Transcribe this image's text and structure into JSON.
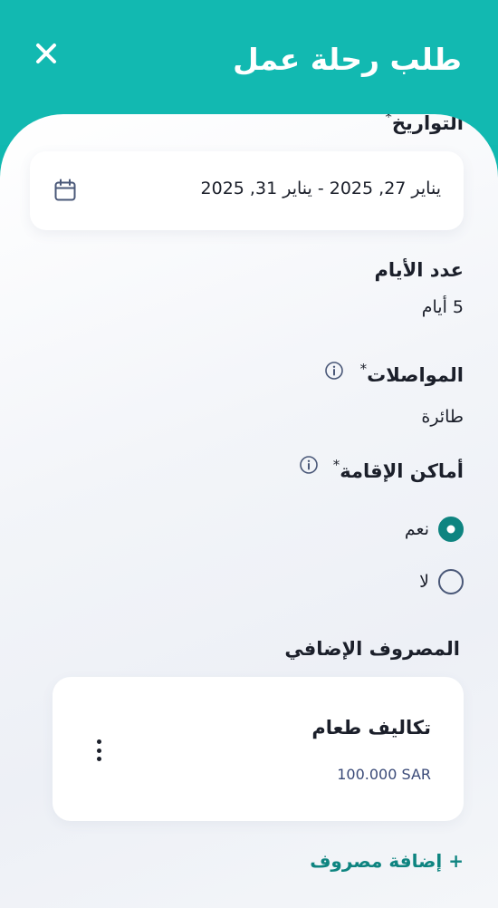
{
  "header": {
    "title": "طلب رحلة عمل",
    "close_icon": "close-icon"
  },
  "dates": {
    "label": "التواريخ",
    "required_mark": "*",
    "value": "يناير 27, 2025 - يناير 31, 2025",
    "icon": "calendar-icon"
  },
  "days": {
    "label": "عدد الأيام",
    "value": "5 أيام"
  },
  "transport": {
    "label": "المواصلات",
    "required_mark": "*",
    "value": "طائرة",
    "icon": "info-icon"
  },
  "accommodation": {
    "label": "أماكن الإقامة",
    "required_mark": "*",
    "icon": "info-icon",
    "options": [
      {
        "label": "نعم",
        "selected": true
      },
      {
        "label": "لا",
        "selected": false
      }
    ]
  },
  "extra_expense": {
    "label": "المصروف الإضافي",
    "items": [
      {
        "title": "تكاليف طعام",
        "amount": "100.000 SAR",
        "menu_icon": "kebab-menu-icon"
      }
    ],
    "add_label": "+ إضافة مصروف"
  },
  "colors": {
    "brand": "#12b9b1",
    "accent_dark": "#0e8480",
    "text": "#1b1f2a",
    "amount_text": "#3a4a78"
  }
}
